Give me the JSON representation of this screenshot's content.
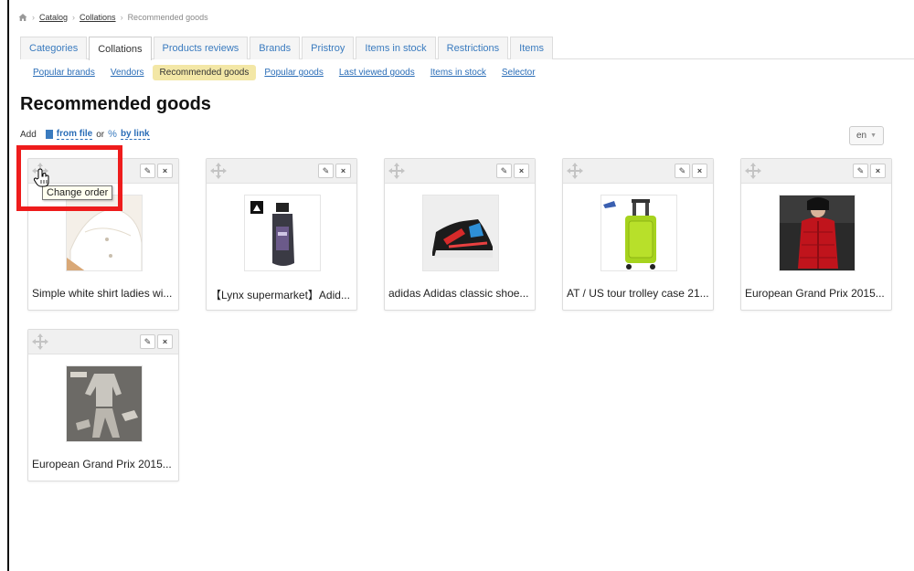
{
  "breadcrumb": {
    "items": [
      "Catalog",
      "Collations",
      "Recommended goods"
    ]
  },
  "tabs": [
    "Categories",
    "Collations",
    "Products reviews",
    "Brands",
    "Pristroy",
    "Items in stock",
    "Restrictions",
    "Items"
  ],
  "active_tab": "Collations",
  "subnav": [
    "Popular brands",
    "Vendors",
    "Recommended goods",
    "Popular goods",
    "Last viewed goods",
    "Items in stock",
    "Selector"
  ],
  "active_subnav": "Recommended goods",
  "page": {
    "title": "Recommended goods"
  },
  "add": {
    "label": "Add",
    "from_file": "from file",
    "or": "or",
    "by_link": "by link"
  },
  "language": {
    "selected": "en"
  },
  "tooltip": "Change order",
  "products": [
    {
      "name": "Simple white shirt ladies wi...",
      "image": "white-shirt"
    },
    {
      "name": "【Lynx supermarket】Adid...",
      "image": "adidas-shower-gel"
    },
    {
      "name": "adidas Adidas classic shoe...",
      "image": "sneaker"
    },
    {
      "name": "AT / US tour trolley case 21...",
      "image": "trolley-suitcase"
    },
    {
      "name": "European Grand Prix 2015...",
      "image": "red-jacket"
    },
    {
      "name": "European Grand Prix 2015...",
      "image": "grey-outfit"
    }
  ],
  "colors": {
    "accent": "#3a7bbf",
    "highlight": "#ee1c1c",
    "active_pill": "#f3e7a6"
  }
}
